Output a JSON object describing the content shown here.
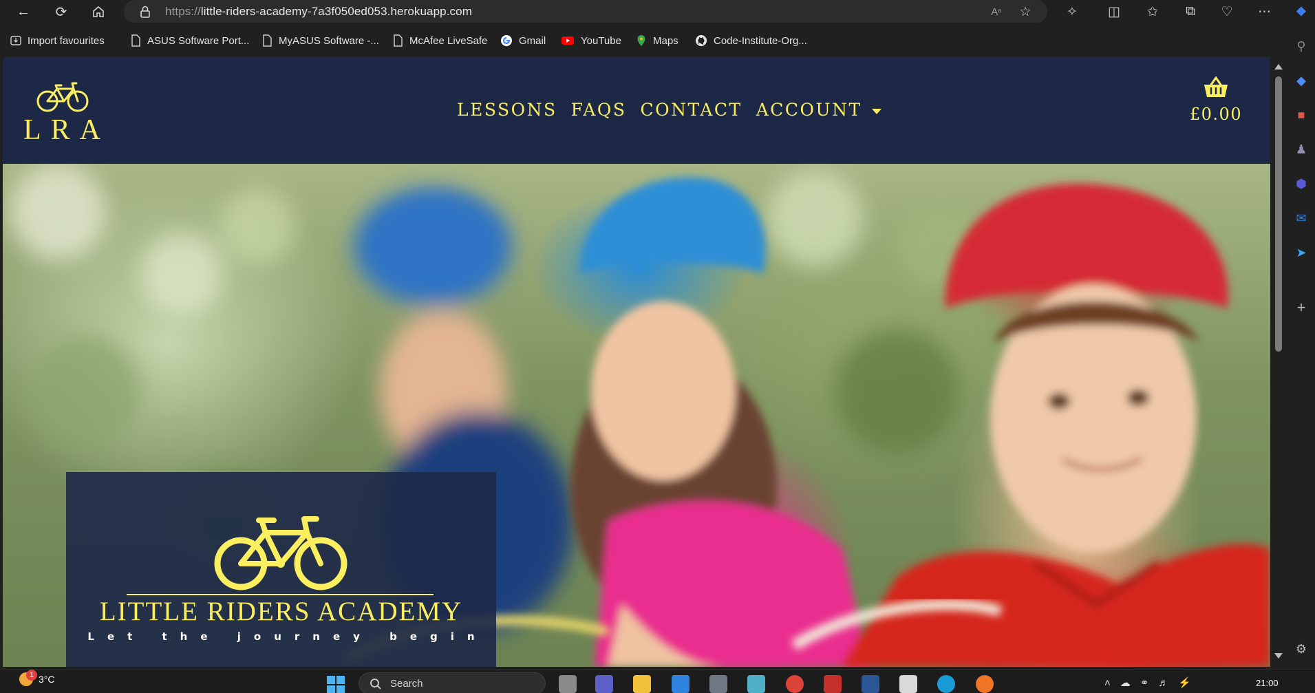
{
  "browser": {
    "url_prefix": "https://",
    "url_host": "little-riders-academy-7a3f050ed053.herokuapp.com",
    "favourites": [
      {
        "label": "Import favourites",
        "icon": "import-icon"
      },
      {
        "label": "ASUS Software Port...",
        "icon": "page-icon"
      },
      {
        "label": "MyASUS Software -...",
        "icon": "page-icon"
      },
      {
        "label": "McAfee LiveSafe",
        "icon": "page-icon"
      },
      {
        "label": "Gmail",
        "icon": "google-icon"
      },
      {
        "label": "YouTube",
        "icon": "youtube-icon"
      },
      {
        "label": "Maps",
        "icon": "maps-icon"
      },
      {
        "label": "Code-Institute-Org...",
        "icon": "github-icon"
      }
    ]
  },
  "site": {
    "logo_letters": "LRA",
    "nav": [
      {
        "label": "LESSONS"
      },
      {
        "label": "FAQS"
      },
      {
        "label": "CONTACT"
      },
      {
        "label": "ACCOUNT"
      }
    ],
    "cart_total": "£0.00",
    "brand_title": "LITTLE RIDERS ACADEMY",
    "brand_tagline": "Let the journey begin",
    "accent_color": "#fbef5f",
    "navy_color": "#1d2847"
  },
  "taskbar": {
    "weather": "3°C",
    "notification_count": "1",
    "search_placeholder": "Search",
    "time": "21:00"
  }
}
